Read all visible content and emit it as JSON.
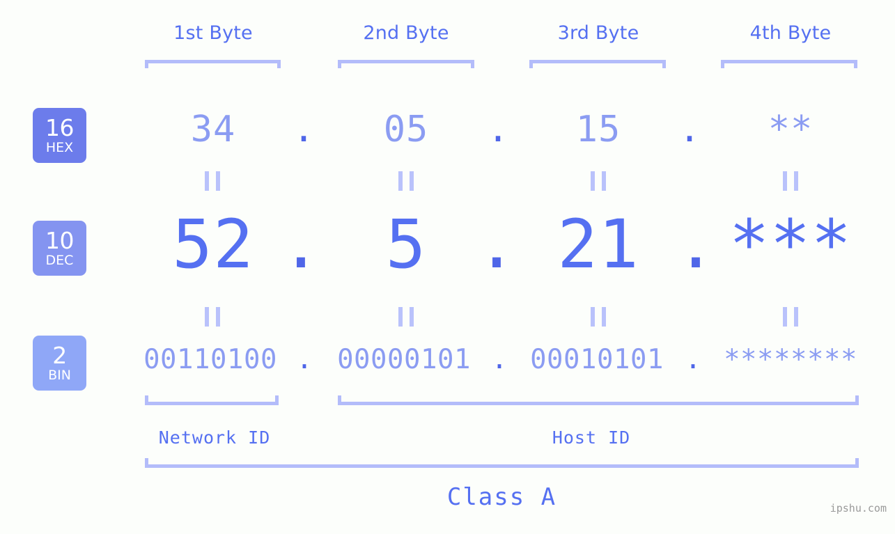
{
  "meta": {
    "background_color": "#fcfefb",
    "accent_color": "#5570f1",
    "light_accent_color": "#b3bcfa",
    "watermark": "ipshu.com"
  },
  "byte_headers": [
    {
      "label": "1st Byte"
    },
    {
      "label": "2nd Byte"
    },
    {
      "label": "3rd Byte"
    },
    {
      "label": "4th Byte"
    }
  ],
  "bases": [
    {
      "number": "16",
      "name": "HEX",
      "color": "#6c7ceb"
    },
    {
      "number": "10",
      "name": "DEC",
      "color": "#8494f0"
    },
    {
      "number": "2",
      "name": "BIN",
      "color": "#8fa7f7"
    }
  ],
  "rows": {
    "hex": {
      "base_number": "16",
      "base_name": "HEX",
      "values": [
        "34",
        "05",
        "15",
        "**"
      ],
      "separators": [
        ".",
        ".",
        "."
      ]
    },
    "dec": {
      "base_number": "10",
      "base_name": "DEC",
      "values": [
        "52",
        "5",
        "21",
        "***"
      ],
      "separators": [
        ".",
        ".",
        "."
      ]
    },
    "bin": {
      "base_number": "2",
      "base_name": "BIN",
      "values": [
        "00110100",
        "00000101",
        "00010101",
        "********"
      ],
      "separators": [
        ".",
        ".",
        "."
      ]
    }
  },
  "id_sections": [
    {
      "label": "Network ID"
    },
    {
      "label": "Host ID"
    }
  ],
  "class_section": {
    "label": "Class A"
  },
  "chart_data": {
    "type": "table",
    "title": "IP Address Byte Breakdown",
    "columns": [
      "1st Byte",
      "2nd Byte",
      "3rd Byte",
      "4th Byte"
    ],
    "rows": [
      {
        "base": "16 HEX",
        "cells": [
          "34",
          "05",
          "15",
          "**"
        ]
      },
      {
        "base": "10 DEC",
        "cells": [
          "52",
          "5",
          "21",
          "***"
        ]
      },
      {
        "base": "2 BIN",
        "cells": [
          "00110100",
          "00000101",
          "00010101",
          "********"
        ]
      }
    ],
    "network_id_bytes": 1,
    "host_id_bytes": 3,
    "ip_class": "Class A"
  }
}
